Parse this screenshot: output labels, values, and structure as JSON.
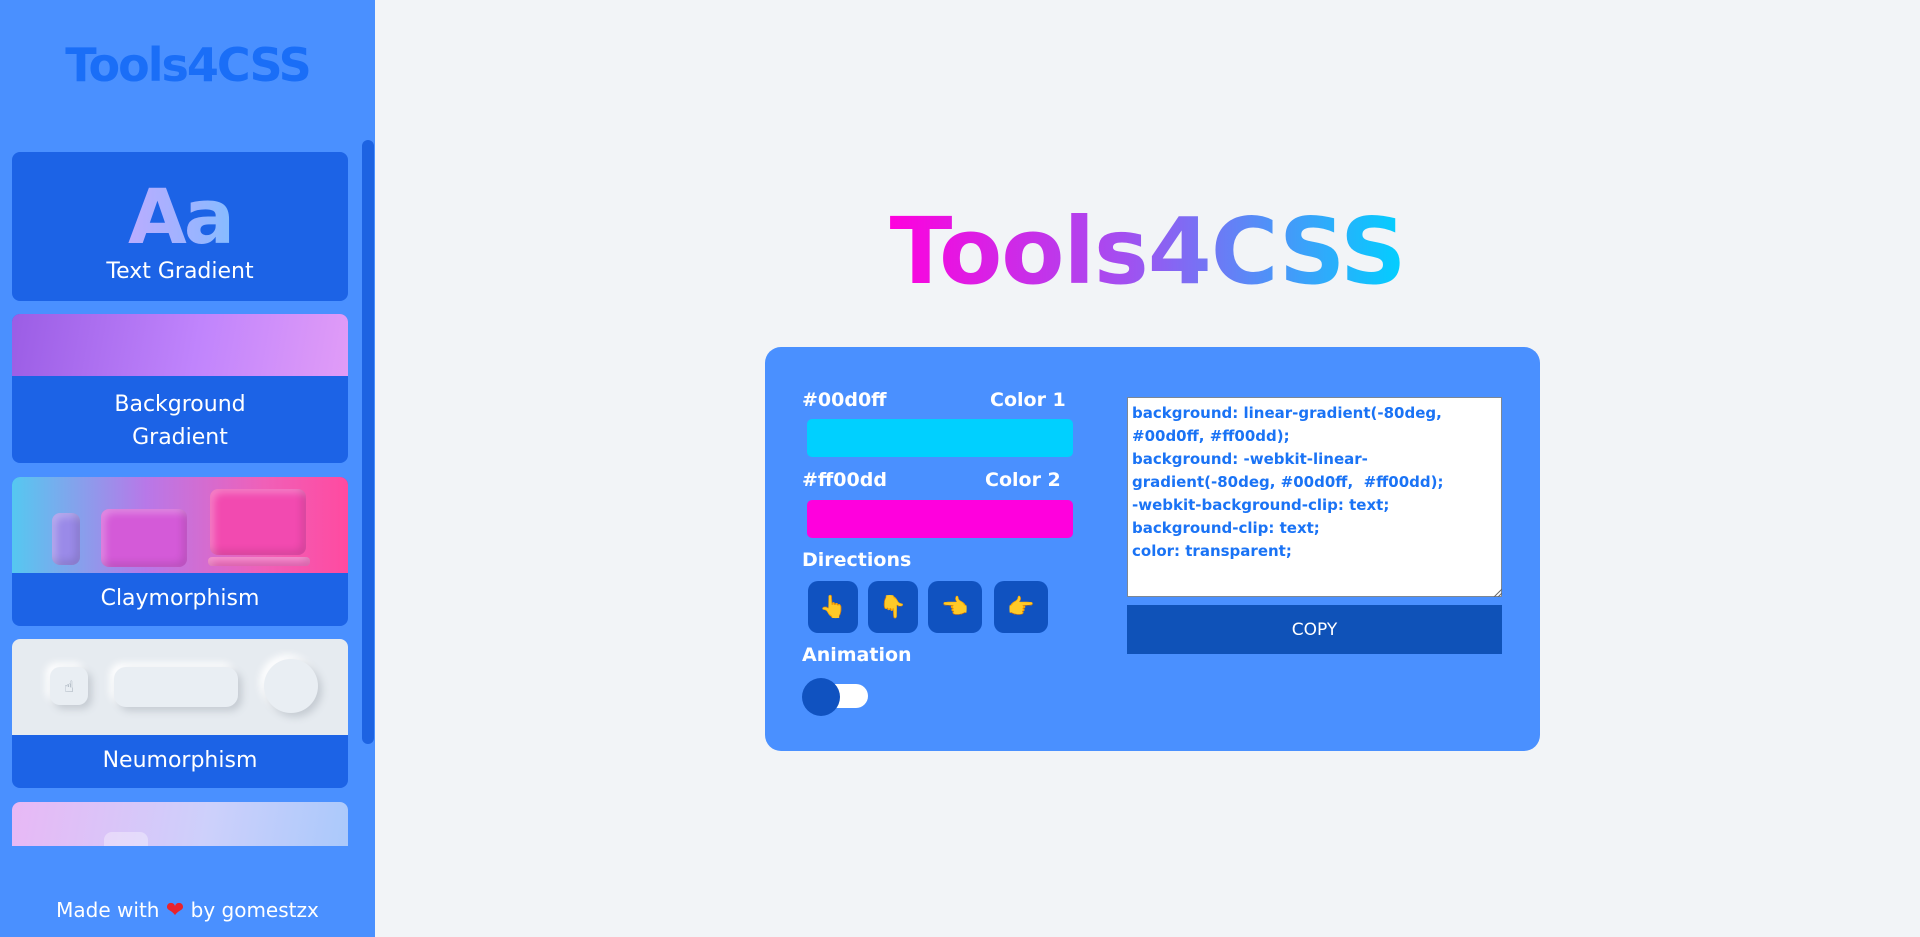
{
  "sidebar": {
    "brand": "Tools4CSS",
    "cards": [
      {
        "label": "Text Gradient",
        "preview": "Aa"
      },
      {
        "label": "Background\nGradient"
      },
      {
        "label": "Claymorphism"
      },
      {
        "label": "Neumorphism"
      },
      {
        "label": ""
      }
    ],
    "footer": {
      "prefix": "Made with",
      "heart": "❤",
      "suffix": "by gomestzx"
    }
  },
  "hero": {
    "title": "Tools4CSS"
  },
  "controls": {
    "color1": {
      "hex": "#00d0ff",
      "label": "Color 1"
    },
    "color2": {
      "hex": "#ff00dd",
      "label": "Color 2"
    },
    "directions_label": "Directions",
    "directions": [
      "👆",
      "👇",
      "👈",
      "👉"
    ],
    "animation_label": "Animation",
    "animation_on": false
  },
  "output": {
    "code": "background: linear-gradient(-80deg, #00d0ff, #ff00dd);\nbackground: -webkit-linear-gradient(-80deg, #00d0ff,  #ff00dd);\n-webkit-background-clip: text;\nbackground-clip: text;\ncolor: transparent;",
    "copy_label": "COPY"
  },
  "colors": {
    "sidebar_bg": "#4a90ff",
    "card_bg": "#1c63e6",
    "panel_bg": "#4a90ff",
    "button_dark": "#0f52b8",
    "code_text": "#1a73f5",
    "page_bg": "#f2f4f7"
  }
}
